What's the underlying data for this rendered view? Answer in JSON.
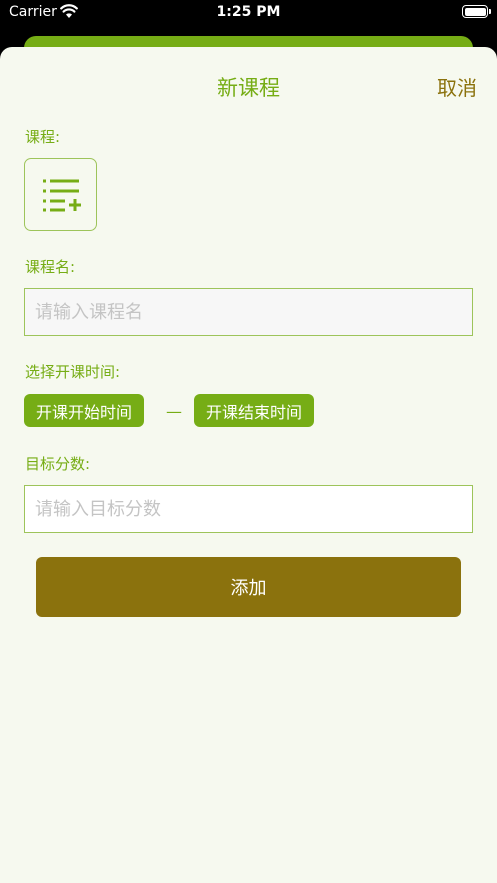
{
  "status_bar": {
    "carrier": "Carrier",
    "time": "1:25 PM",
    "icons": [
      "wifi-icon",
      "battery-icon"
    ]
  },
  "sheet": {
    "title": "新课程",
    "cancel_label": "取消"
  },
  "form": {
    "course_label": "课程:",
    "course_icon": "list-add-icon",
    "name_label": "课程名:",
    "name_placeholder": "请输入课程名",
    "time_label": "选择开课时间:",
    "start_time_label": "开课开始时间",
    "separator": "—",
    "end_time_label": "开课结束时间",
    "score_label": "目标分数:",
    "score_placeholder": "请输入目标分数",
    "submit_label": "添加"
  },
  "colors": {
    "accent_green": "#76ad15",
    "accent_brown": "#8b720d",
    "sheet_background": "#f6f9ef"
  }
}
